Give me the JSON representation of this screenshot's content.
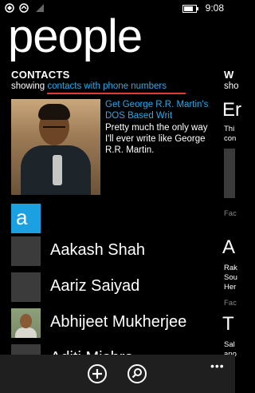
{
  "status": {
    "time": "9:08",
    "battery_level": 0.8
  },
  "page": {
    "title": "people"
  },
  "contacts_section": {
    "heading": "CONTACTS",
    "showing_prefix": "showing",
    "filter_link": "contacts with phone numbers"
  },
  "feed_item": {
    "link": "Get George R.R. Martin's DOS Based Writ",
    "text": "Pretty much the only way I'll ever write like George R.R. Martin."
  },
  "whats_new": {
    "heading": "W",
    "sub": "sho",
    "peek": [
      {
        "big": "Er",
        "lines": [
          "Thi",
          "con"
        ]
      },
      {
        "gray": "Fac"
      },
      {
        "big": "A",
        "lines": [
          "Rak",
          "Sou",
          "Her"
        ]
      },
      {
        "gray": "Fac"
      },
      {
        "big": "T",
        "lines": [
          "Sal",
          "ano"
        ]
      }
    ]
  },
  "group_letter": "a",
  "contacts": [
    {
      "name": "Aakash Shah",
      "photo": false
    },
    {
      "name": "Aariz Saiyad",
      "photo": false
    },
    {
      "name": "Abhijeet Mukherjee",
      "photo": true
    },
    {
      "name": "Aditi Mishra",
      "photo": false
    }
  ],
  "app_bar": {
    "add_label": "+",
    "more": "•••"
  },
  "colors": {
    "accent": "#1ba1e2",
    "link": "#2fa8e4",
    "highlight": "#e03a3a"
  }
}
